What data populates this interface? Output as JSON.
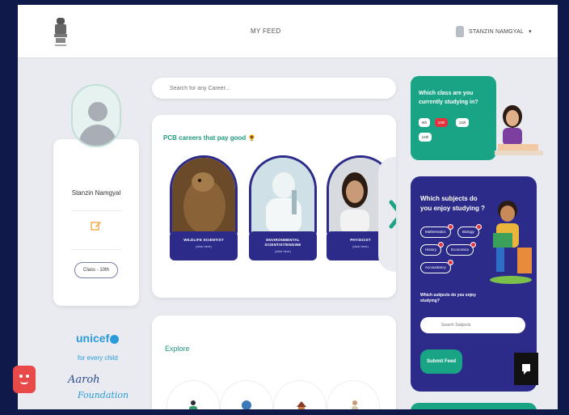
{
  "header": {
    "nav_feed": "MY FEED",
    "user_name": "STANZIN NAMGYAL"
  },
  "profile": {
    "name": "Stanzin Namgyal",
    "class_label": "Class - 10th"
  },
  "partners": {
    "unicef": "unicef",
    "unicef_tagline": "for every child",
    "aaroh": "Aaroh",
    "aaroh_sub": "Foundation"
  },
  "search": {
    "placeholder": "Search for any Career..."
  },
  "careers": {
    "title": "PCB careers that pay good",
    "items": [
      {
        "title": "WILDLIFE SCIENTIST",
        "cta": "(click here)"
      },
      {
        "title": "ENVIRONMENTAL SCIENTIST/ENGINE",
        "cta": "(click here)"
      },
      {
        "title": "PHYSICIST",
        "cta": "(click here)"
      }
    ]
  },
  "explore": {
    "title": "Explore"
  },
  "class_question": {
    "title": "Which class are you currently studying in?",
    "options": [
      "9th",
      "10th",
      "11th",
      "12th"
    ],
    "selected": "10th"
  },
  "subjects": {
    "title": "Which subjects do you enjoy studying ?",
    "chips": [
      "Mathematics",
      "Biology",
      "History",
      "Economics",
      "Accountancy"
    ],
    "input_question": "Which subjects do you enjoy studying?",
    "input_placeholder": "Search Subjects",
    "submit": "Submit Feed"
  },
  "colors": {
    "teal": "#1aa486",
    "indigo": "#2d2b8a",
    "red": "#e5323f"
  }
}
